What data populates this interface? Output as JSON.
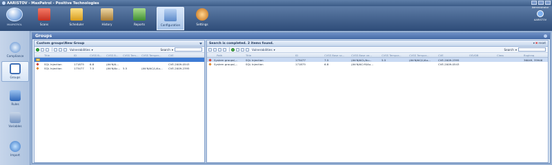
{
  "window": {
    "title": "AARISTOV - MaxPatrol - Positive Technologies"
  },
  "ribbon": {
    "app_label": "MAXPATROL",
    "tools": [
      {
        "label": "Scans",
        "color": "#e24a3a"
      },
      {
        "label": "Scheduler",
        "color": "#f2c344"
      },
      {
        "label": "History",
        "color": "#c9a35c"
      },
      {
        "label": "Reports",
        "color": "#6fb05d"
      },
      {
        "label": "Configuration",
        "color": "#7ba4d8",
        "active": true
      },
      {
        "label": "Settings",
        "color": "#e19b3b"
      }
    ],
    "admin_top": "Administrator",
    "admin_label": "AARISTOV"
  },
  "sidebar": {
    "items": [
      {
        "label": "Compliance",
        "color": "#5e8fd0"
      },
      {
        "label": "Groups",
        "color": "#3f6fb6",
        "active": true
      },
      {
        "label": "Rules",
        "color": "#4c83cf"
      },
      {
        "label": "Variables",
        "color": "#7494c2"
      },
      {
        "label": "Import",
        "color": "#3977c7"
      }
    ]
  },
  "main": {
    "title": "Groups"
  },
  "left_pane": {
    "header": "Custom groups\\New Group",
    "toolbar": {
      "vulnerabilities": "Vulnerabilities",
      "search_label": "Search",
      "search_value": ""
    },
    "columns": [
      "Title",
      "ID",
      "CVSS B...",
      "CVSS B...",
      "CVSS Tem...",
      "CVSS Temper...",
      "CVE"
    ],
    "rows": [
      {
        "folder": true,
        "selected": true,
        "cells": [
          "",
          "",
          "",
          "",
          "",
          "",
          ""
        ]
      },
      {
        "severity": "red",
        "cells": [
          "SQL Injection",
          "171875",
          "6.8",
          "(AV:N/A...",
          "",
          "",
          "CVE-2009-0543"
        ]
      },
      {
        "severity": "orange",
        "cells": [
          "SQL Injection",
          "173477",
          "7.5",
          "(AV:N/Ac...",
          "5.5",
          "(AV:N/AC/L/Au...",
          "CVE-2009-2395"
        ]
      }
    ]
  },
  "right_pane": {
    "header": "Search is completed. 2 items found.",
    "reset_label": "reset",
    "toolbar": {
      "vulnerabilities": "Vulnerabilities",
      "search_label": "Search",
      "search_value": ""
    },
    "columns": [
      "Path",
      "Title",
      "ID",
      "CVSS Base sc...",
      "CVSS Base ve...",
      "CVSS Tempor...",
      "CVSS Tempor...",
      "CVE",
      "OSVDB",
      "Class",
      "Bugtraq"
    ],
    "rows": [
      {
        "severity": "red",
        "highlight": true,
        "cells": [
          "System groups\\...",
          "SQL Injection",
          "173477",
          "7.5",
          "(AV:N/ACL/Au...",
          "5.5",
          "(AV:N/AC/L/Au...",
          "CVE-2009-2395",
          "",
          "",
          "36049, 35946"
        ]
      },
      {
        "severity": "orange",
        "cells": [
          "System groups\\...",
          "SQL Injection",
          "171875",
          "6.8",
          "(AV:N/AC:M/Au...",
          "",
          "",
          "CVE-2009-0543",
          "",
          "",
          ""
        ]
      }
    ]
  }
}
